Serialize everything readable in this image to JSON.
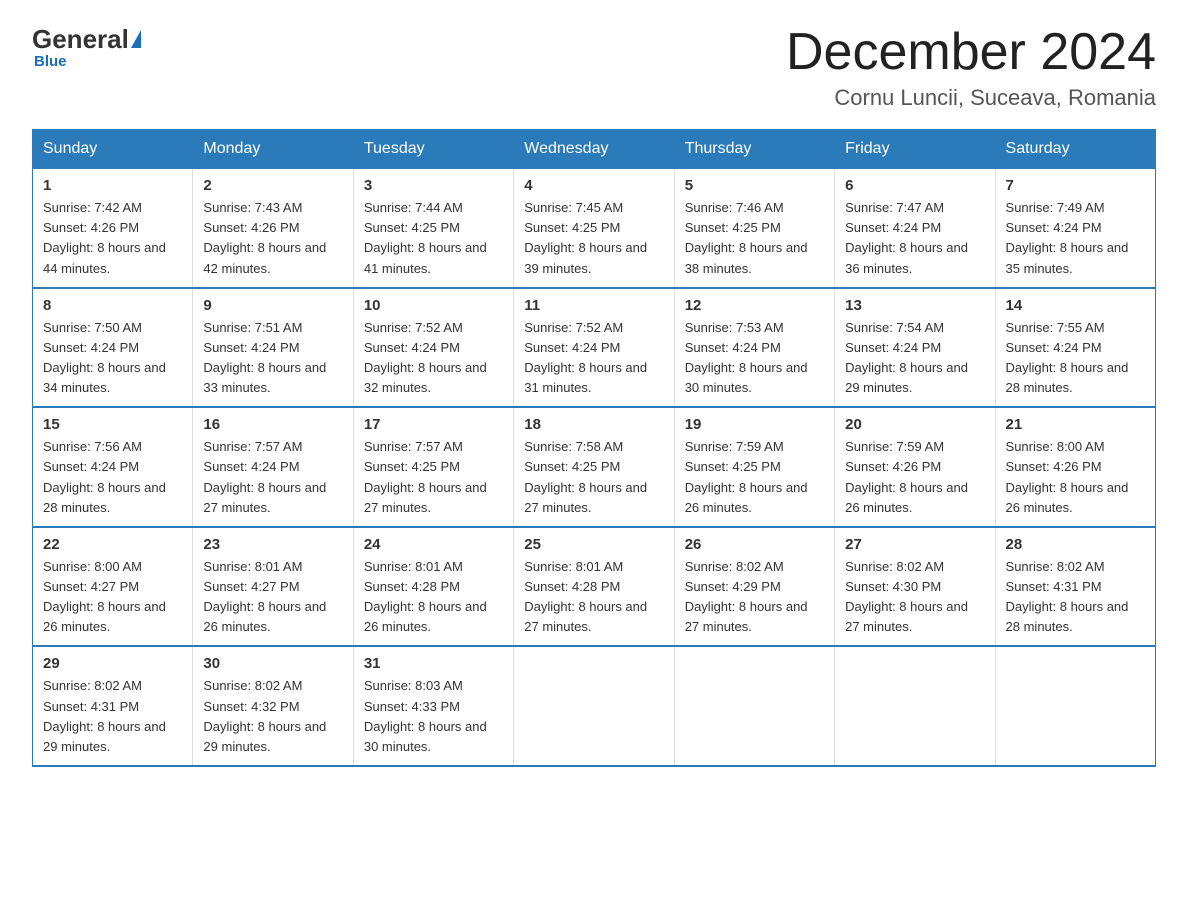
{
  "logo": {
    "general": "General",
    "blue": "Blue",
    "subtitle": "Blue"
  },
  "header": {
    "month": "December 2024",
    "location": "Cornu Luncii, Suceava, Romania"
  },
  "weekdays": [
    "Sunday",
    "Monday",
    "Tuesday",
    "Wednesday",
    "Thursday",
    "Friday",
    "Saturday"
  ],
  "weeks": [
    [
      {
        "day": "1",
        "sunrise": "7:42 AM",
        "sunset": "4:26 PM",
        "daylight": "8 hours and 44 minutes."
      },
      {
        "day": "2",
        "sunrise": "7:43 AM",
        "sunset": "4:26 PM",
        "daylight": "8 hours and 42 minutes."
      },
      {
        "day": "3",
        "sunrise": "7:44 AM",
        "sunset": "4:25 PM",
        "daylight": "8 hours and 41 minutes."
      },
      {
        "day": "4",
        "sunrise": "7:45 AM",
        "sunset": "4:25 PM",
        "daylight": "8 hours and 39 minutes."
      },
      {
        "day": "5",
        "sunrise": "7:46 AM",
        "sunset": "4:25 PM",
        "daylight": "8 hours and 38 minutes."
      },
      {
        "day": "6",
        "sunrise": "7:47 AM",
        "sunset": "4:24 PM",
        "daylight": "8 hours and 36 minutes."
      },
      {
        "day": "7",
        "sunrise": "7:49 AM",
        "sunset": "4:24 PM",
        "daylight": "8 hours and 35 minutes."
      }
    ],
    [
      {
        "day": "8",
        "sunrise": "7:50 AM",
        "sunset": "4:24 PM",
        "daylight": "8 hours and 34 minutes."
      },
      {
        "day": "9",
        "sunrise": "7:51 AM",
        "sunset": "4:24 PM",
        "daylight": "8 hours and 33 minutes."
      },
      {
        "day": "10",
        "sunrise": "7:52 AM",
        "sunset": "4:24 PM",
        "daylight": "8 hours and 32 minutes."
      },
      {
        "day": "11",
        "sunrise": "7:52 AM",
        "sunset": "4:24 PM",
        "daylight": "8 hours and 31 minutes."
      },
      {
        "day": "12",
        "sunrise": "7:53 AM",
        "sunset": "4:24 PM",
        "daylight": "8 hours and 30 minutes."
      },
      {
        "day": "13",
        "sunrise": "7:54 AM",
        "sunset": "4:24 PM",
        "daylight": "8 hours and 29 minutes."
      },
      {
        "day": "14",
        "sunrise": "7:55 AM",
        "sunset": "4:24 PM",
        "daylight": "8 hours and 28 minutes."
      }
    ],
    [
      {
        "day": "15",
        "sunrise": "7:56 AM",
        "sunset": "4:24 PM",
        "daylight": "8 hours and 28 minutes."
      },
      {
        "day": "16",
        "sunrise": "7:57 AM",
        "sunset": "4:24 PM",
        "daylight": "8 hours and 27 minutes."
      },
      {
        "day": "17",
        "sunrise": "7:57 AM",
        "sunset": "4:25 PM",
        "daylight": "8 hours and 27 minutes."
      },
      {
        "day": "18",
        "sunrise": "7:58 AM",
        "sunset": "4:25 PM",
        "daylight": "8 hours and 27 minutes."
      },
      {
        "day": "19",
        "sunrise": "7:59 AM",
        "sunset": "4:25 PM",
        "daylight": "8 hours and 26 minutes."
      },
      {
        "day": "20",
        "sunrise": "7:59 AM",
        "sunset": "4:26 PM",
        "daylight": "8 hours and 26 minutes."
      },
      {
        "day": "21",
        "sunrise": "8:00 AM",
        "sunset": "4:26 PM",
        "daylight": "8 hours and 26 minutes."
      }
    ],
    [
      {
        "day": "22",
        "sunrise": "8:00 AM",
        "sunset": "4:27 PM",
        "daylight": "8 hours and 26 minutes."
      },
      {
        "day": "23",
        "sunrise": "8:01 AM",
        "sunset": "4:27 PM",
        "daylight": "8 hours and 26 minutes."
      },
      {
        "day": "24",
        "sunrise": "8:01 AM",
        "sunset": "4:28 PM",
        "daylight": "8 hours and 26 minutes."
      },
      {
        "day": "25",
        "sunrise": "8:01 AM",
        "sunset": "4:28 PM",
        "daylight": "8 hours and 27 minutes."
      },
      {
        "day": "26",
        "sunrise": "8:02 AM",
        "sunset": "4:29 PM",
        "daylight": "8 hours and 27 minutes."
      },
      {
        "day": "27",
        "sunrise": "8:02 AM",
        "sunset": "4:30 PM",
        "daylight": "8 hours and 27 minutes."
      },
      {
        "day": "28",
        "sunrise": "8:02 AM",
        "sunset": "4:31 PM",
        "daylight": "8 hours and 28 minutes."
      }
    ],
    [
      {
        "day": "29",
        "sunrise": "8:02 AM",
        "sunset": "4:31 PM",
        "daylight": "8 hours and 29 minutes."
      },
      {
        "day": "30",
        "sunrise": "8:02 AM",
        "sunset": "4:32 PM",
        "daylight": "8 hours and 29 minutes."
      },
      {
        "day": "31",
        "sunrise": "8:03 AM",
        "sunset": "4:33 PM",
        "daylight": "8 hours and 30 minutes."
      },
      null,
      null,
      null,
      null
    ]
  ],
  "labels": {
    "sunrise": "Sunrise:",
    "sunset": "Sunset:",
    "daylight": "Daylight:"
  }
}
